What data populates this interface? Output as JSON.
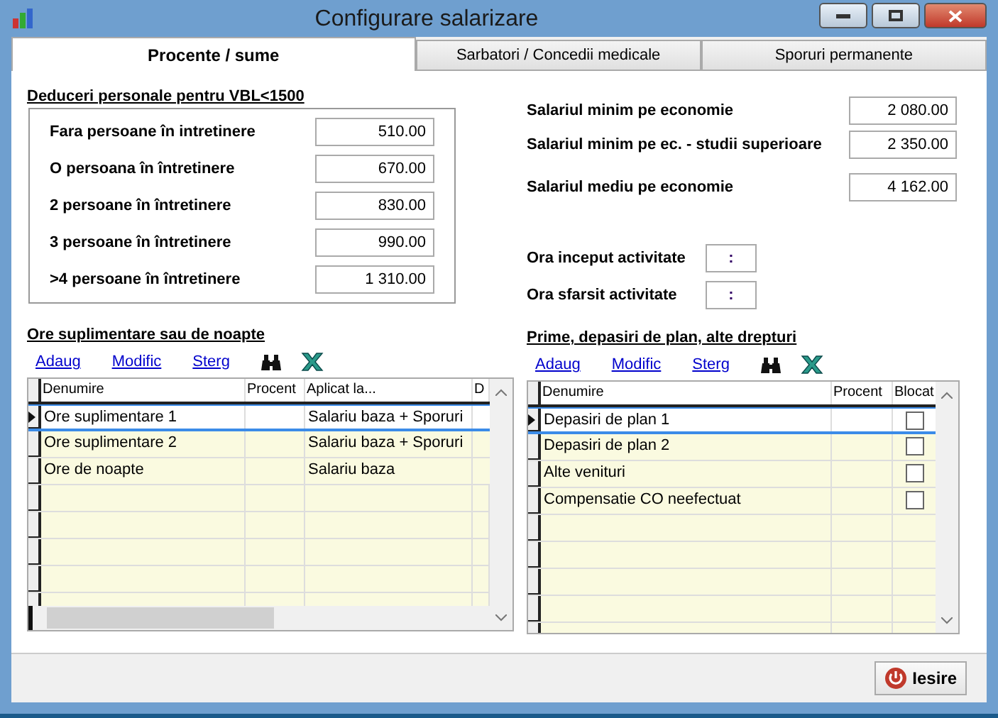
{
  "window": {
    "title": "Configurare salarizare"
  },
  "tabs": [
    {
      "label": "Procente / sume",
      "selected": true
    },
    {
      "label": "Sarbatori / Concedii medicale",
      "selected": false
    },
    {
      "label": "Sporuri permanente",
      "selected": false
    }
  ],
  "deductions": {
    "title": "Deduceri personale pentru VBL<1500",
    "items": [
      {
        "label": "Fara persoane în intretinere",
        "value": "510.00"
      },
      {
        "label": "O persoana în întretinere",
        "value": "670.00"
      },
      {
        "label": "2 persoane în întretinere",
        "value": "830.00"
      },
      {
        "label": "3 persoane în întretinere",
        "value": "990.00"
      },
      {
        "label": ">4 persoane în întretinere",
        "value": "1 310.00"
      }
    ]
  },
  "salaries": [
    {
      "label": "Salariul minim pe economie",
      "value": "2 080.00"
    },
    {
      "label": "Salariul minim pe ec. - studii superioare",
      "value": "2 350.00"
    },
    {
      "label": "Salariul mediu pe economie",
      "value": "4 162.00"
    }
  ],
  "hours": [
    {
      "label": "Ora inceput activitate",
      "value": ":"
    },
    {
      "label": "Ora sfarsit activitate",
      "value": ":"
    }
  ],
  "overtime": {
    "title": "Ore suplimentare sau de noapte",
    "actions": [
      "Adaug",
      "Modific",
      "Sterg"
    ],
    "columns": [
      "Denumire",
      "Procent",
      "Aplicat la...",
      "D"
    ],
    "rows": [
      {
        "cells": [
          "Ore suplimentare 1",
          "",
          "Salariu baza + Sporuri"
        ],
        "selected": true
      },
      {
        "cells": [
          "Ore suplimentare 2",
          "",
          "Salariu baza + Sporuri"
        ],
        "selected": false
      },
      {
        "cells": [
          "Ore de noapte",
          "",
          "Salariu baza"
        ],
        "selected": false
      }
    ]
  },
  "bonuses": {
    "title": "Prime, depasiri de plan, alte drepturi",
    "actions": [
      "Adaug",
      "Modific",
      "Sterg"
    ],
    "columns": [
      "Denumire",
      "Procent",
      "Blocat"
    ],
    "rows": [
      {
        "name": "Depasiri de plan 1",
        "blocked": false,
        "selected": true
      },
      {
        "name": "Depasiri de plan 2",
        "blocked": false,
        "selected": false
      },
      {
        "name": "Alte venituri",
        "blocked": false,
        "selected": false
      },
      {
        "name": "Compensatie CO neefectuat",
        "blocked": false,
        "selected": false
      }
    ]
  },
  "exit_button": "Iesire"
}
